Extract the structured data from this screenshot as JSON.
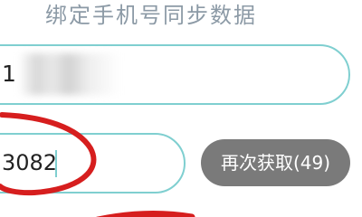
{
  "header": {
    "title": "绑定手机号同步数据"
  },
  "form": {
    "phone": {
      "visible_value": "1"
    },
    "code": {
      "value": "3082"
    },
    "resend_label": "再次获取(49)"
  },
  "colors": {
    "title_text": "#8c9aa6",
    "input_border": "#7fcfd0",
    "button_background": "#7a7a7a",
    "button_text": "#ffffff",
    "annotation_stroke": "#d61e1e"
  }
}
